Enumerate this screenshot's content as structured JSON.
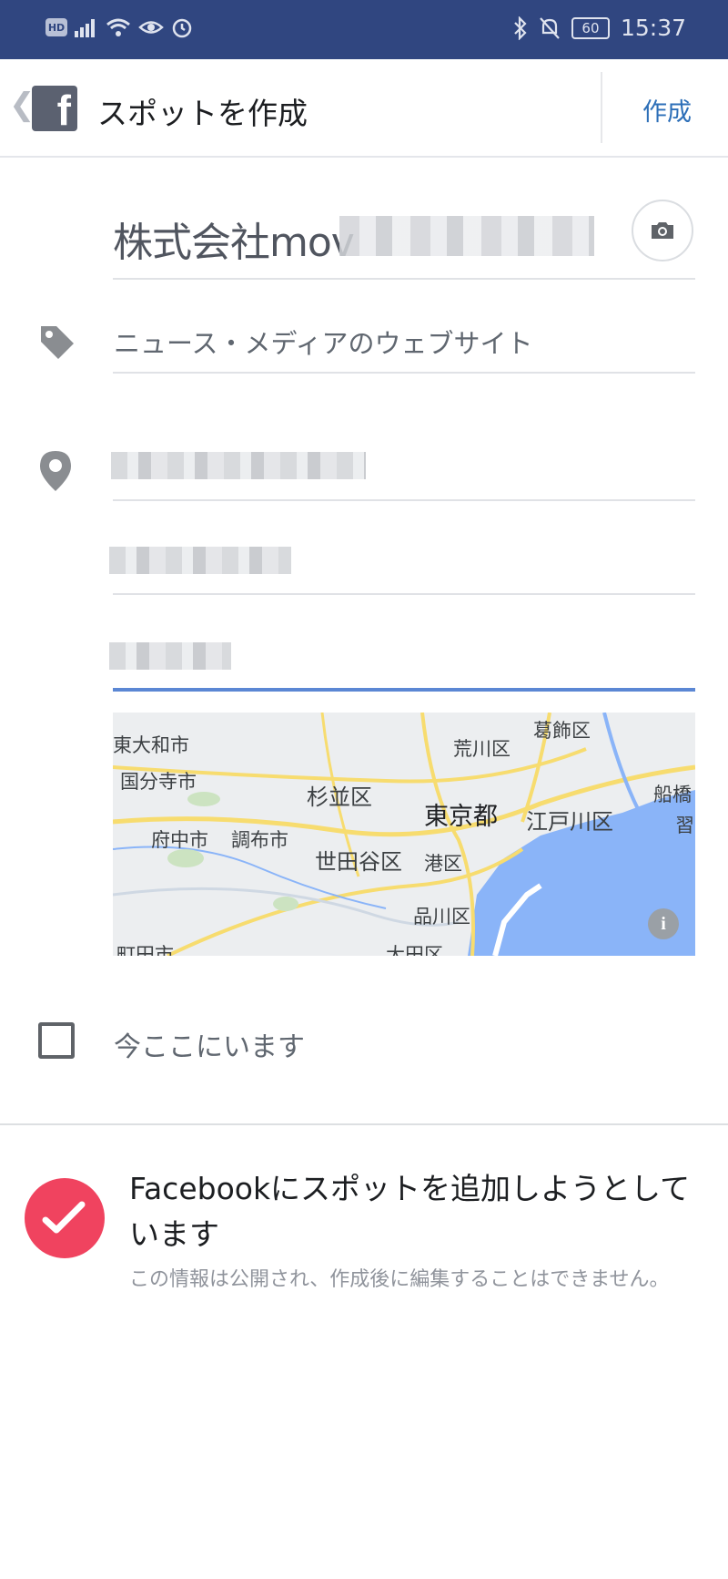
{
  "status_bar": {
    "hd_badge": "HD",
    "battery": "60",
    "time": "15:37"
  },
  "app_bar": {
    "title": "スポットを作成",
    "create_label": "作成"
  },
  "form": {
    "name_value": "株式会社mov",
    "category_value": "ニュース・メディアのウェブサイト"
  },
  "map": {
    "labels": [
      "東大和市",
      "国分寺市",
      "府中市",
      "調布市",
      "杉並区",
      "世田谷区",
      "荒川区",
      "葛飾区",
      "東京都",
      "江戸川区",
      "港区",
      "品川区",
      "船橋",
      "習",
      "町田市",
      "大田区"
    ],
    "info_label": "i"
  },
  "checkin": {
    "label": "今ここにいます"
  },
  "notice": {
    "title": "Facebookにスポットを追加しようとしています",
    "subtitle": "この情報は公開され、作成後に編集することはできません。"
  },
  "colors": {
    "status_bar": "#304680",
    "link_blue": "#2d6fb8",
    "active_underline": "#5b87d4",
    "badge_red": "#f0435f",
    "water": "#8ab4f8"
  },
  "icons": [
    "back-chevron-icon",
    "facebook-logo-icon",
    "camera-icon",
    "tag-icon",
    "location-pin-icon",
    "checkmark-pencil-icon"
  ]
}
